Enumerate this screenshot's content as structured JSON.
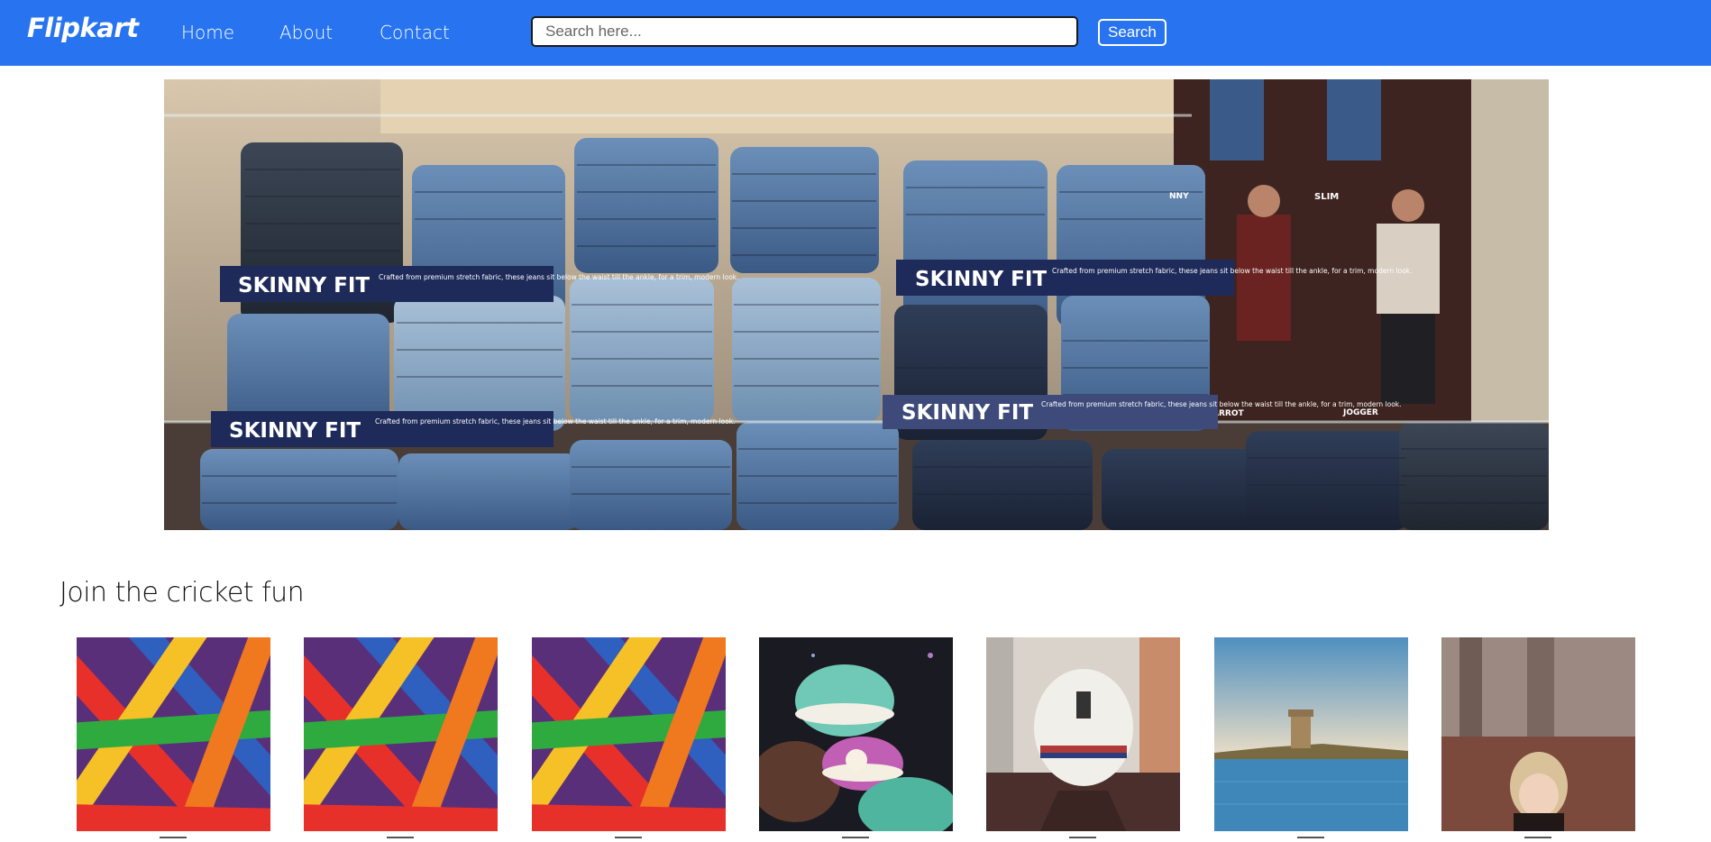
{
  "brand": {
    "name": "Flipkart",
    "color": "#2874f0"
  },
  "nav": {
    "links": [
      {
        "label": "Home"
      },
      {
        "label": "About"
      },
      {
        "label": "Contact"
      }
    ]
  },
  "search": {
    "placeholder": "Search here...",
    "value": "",
    "button_label": "Search"
  },
  "banner": {
    "image": "jeans-stacks-photo",
    "labels": [
      {
        "title": "SKINNY FIT",
        "text": "Crafted from premium stretch fabric, these jeans sit below the waist till the ankle, for a trim, modern look."
      },
      {
        "title": "SKINNY FIT",
        "text": "Crafted from premium stretch fabric, these jeans sit below the waist till the ankle, for a trim, modern look."
      },
      {
        "title": "SKINNY FIT",
        "text": "Crafted from premium stretch fabric, these jeans sit below the waist till the ankle, for a trim, modern look."
      },
      {
        "title": "SKINNY FIT",
        "text": "Crafted from premium stretch fabric, these jeans sit below the waist till the ankle, for a trim, modern look."
      }
    ],
    "poster_labels": [
      "NNY",
      "SLIM",
      "ARROT",
      "JOGGER"
    ]
  },
  "section": {
    "title": "Join the cricket fun",
    "cards": [
      {
        "image": "colorful-sticks-photo"
      },
      {
        "image": "colorful-sticks-photo"
      },
      {
        "image": "colorful-sticks-photo"
      },
      {
        "image": "macarons-photo"
      },
      {
        "image": "astronaut-helmet-photo"
      },
      {
        "image": "sea-tower-photo"
      },
      {
        "image": "child-in-forest-photo"
      }
    ]
  }
}
